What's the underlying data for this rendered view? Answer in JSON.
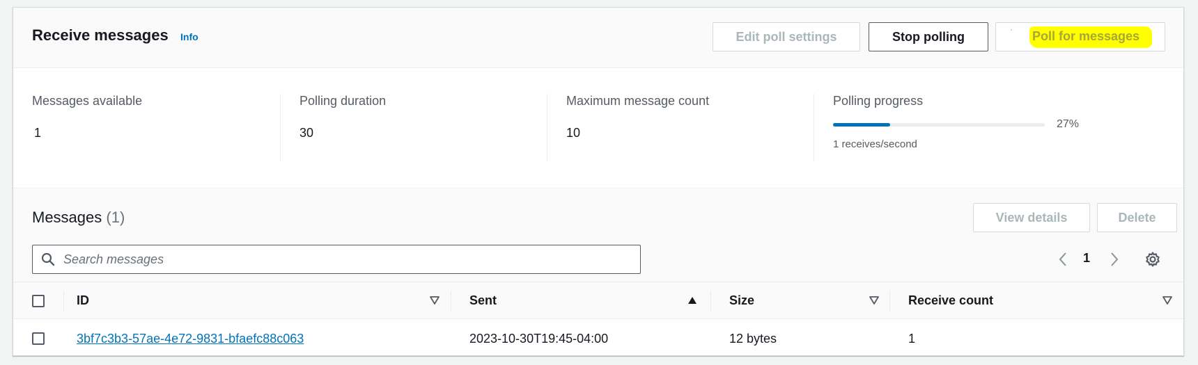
{
  "header": {
    "title": "Receive messages",
    "info_label": "Info",
    "buttons": {
      "edit_poll_settings": "Edit poll settings",
      "stop_polling": "Stop polling",
      "poll_for_messages": "Poll for messages"
    },
    "highlight_color": "#ffff00"
  },
  "stats": {
    "messages_available": {
      "label": "Messages available",
      "value": "1"
    },
    "polling_duration": {
      "label": "Polling duration",
      "value": "30"
    },
    "maximum_message_count": {
      "label": "Maximum message count",
      "value": "10"
    },
    "polling_progress": {
      "label": "Polling progress",
      "percent_text": "27%",
      "percent": 27,
      "rate": "1 receives/second"
    }
  },
  "messages": {
    "title": "Messages",
    "count": "(1)",
    "buttons": {
      "view_details": "View details",
      "delete": "Delete"
    },
    "search": {
      "placeholder": "Search messages",
      "value": ""
    },
    "pagination": {
      "current_page": "1"
    },
    "table": {
      "columns": {
        "id": "ID",
        "sent": "Sent",
        "size": "Size",
        "receive_count": "Receive count"
      },
      "rows": [
        {
          "id": "3bf7c3b3-57ae-4e72-9831-bfaefc88c063",
          "sent": "2023-10-30T19:45-04:00",
          "size": "12 bytes",
          "receive_count": "1"
        }
      ]
    }
  },
  "colors": {
    "accent": "#0073bb",
    "disabled_text": "#aab7b8",
    "progress_track": "#eaeded"
  }
}
